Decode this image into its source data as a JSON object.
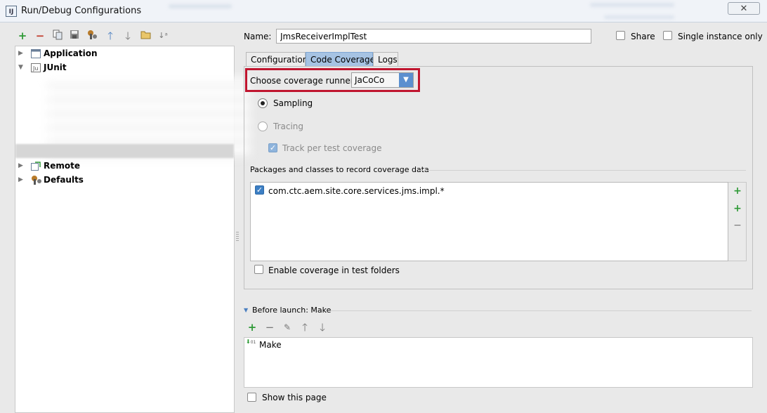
{
  "window": {
    "title": "Run/Debug Configurations",
    "close_glyph": "✕",
    "app_icon": "intellij-icon"
  },
  "left_toolbar": {
    "icons": [
      "add-icon",
      "remove-icon",
      "copy-icon",
      "save-icon",
      "edit-defaults-icon",
      "move-up-icon",
      "move-down-icon",
      "folder-icon",
      "sort-icon"
    ]
  },
  "tree": {
    "items": [
      {
        "label": "Application",
        "expanded": false,
        "icon": "application-icon"
      },
      {
        "label": "JUnit",
        "expanded": true,
        "icon": "junit-icon"
      },
      {
        "label": "Remote",
        "expanded": false,
        "icon": "remote-icon"
      },
      {
        "label": "Defaults",
        "expanded": false,
        "icon": "defaults-icon"
      }
    ]
  },
  "config": {
    "name_label": "Name:",
    "name_value": "JmsReceiverImplTest",
    "share_label": "Share",
    "share_checked": false,
    "single_instance_label": "Single instance only",
    "single_instance_checked": false
  },
  "tabs": [
    {
      "label": "Configuration",
      "active": false
    },
    {
      "label": "Code Coverage",
      "active": true
    },
    {
      "label": "Logs",
      "active": false
    }
  ],
  "coverage": {
    "runner_label": "Choose coverage runner:",
    "runner_value": "JaCoCo",
    "sampling_label": "Sampling",
    "sampling_selected": true,
    "tracing_label": "Tracing",
    "tracing_selected": false,
    "track_per_test_label": "Track per test coverage",
    "track_per_test_checked": true,
    "packages_label": "Packages and classes to record coverage data",
    "packages": [
      {
        "pattern": "com.ctc.aem.site.core.services.jms.impl.*",
        "checked": true
      }
    ],
    "enable_test_folders_label": "Enable coverage in test folders",
    "enable_test_folders_checked": false
  },
  "before_launch": {
    "header": "Before launch: Make",
    "tasks": [
      {
        "label": "Make",
        "icon": "make-icon"
      }
    ],
    "show_page_label": "Show this page",
    "show_page_checked": false
  },
  "colors": {
    "highlight_border": "#c0152f",
    "active_tab": "#a6c3e3",
    "accent": "#3d7fc4"
  }
}
